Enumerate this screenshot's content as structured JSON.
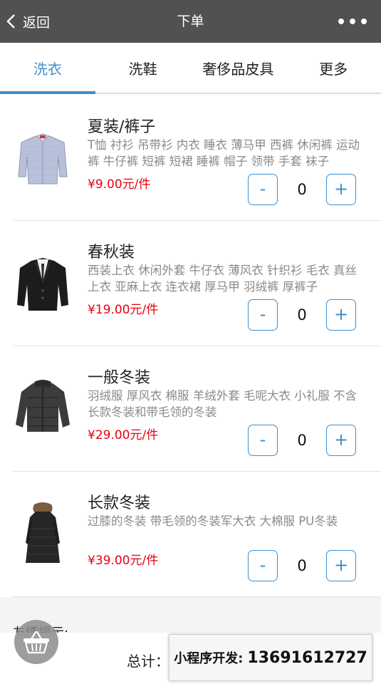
{
  "navbar": {
    "back_label": "返回",
    "title": "下单",
    "more_icon": "more-dots-icon"
  },
  "tabs": [
    {
      "label": "洗衣",
      "active": true
    },
    {
      "label": "洗鞋",
      "active": false
    },
    {
      "label": "奢侈品皮具",
      "active": false
    },
    {
      "label": "更多",
      "active": false
    }
  ],
  "items": [
    {
      "name": "夏装/裤子",
      "desc": "T恤 衬衫 吊带衫 内衣 睡衣 薄马甲 西裤 休闲裤 运动裤 牛仔裤 短裤 短裙 睡裤 帽子 领带 手套 袜子",
      "price": "¥9.00元/件",
      "count": "0",
      "minus": "-",
      "plus": "+",
      "image": "shirt"
    },
    {
      "name": "春秋装",
      "desc": "西装上衣 休闲外套 牛仔衣 薄风衣 针织衫 毛衣 真丝上衣 亚麻上衣 连衣裙 厚马甲 羽绒裤 厚裤子",
      "price": "¥19.00元/件",
      "count": "0",
      "minus": "-",
      "plus": "+",
      "image": "suit"
    },
    {
      "name": "一般冬装",
      "desc": "羽绒服 厚风衣 棉服 羊绒外套 毛呢大衣 小礼服 不含长款冬装和带毛领的冬装",
      "price": "¥29.00元/件",
      "count": "0",
      "minus": "-",
      "plus": "+",
      "image": "down-jacket"
    },
    {
      "name": "长款冬装",
      "desc": "过膝的冬装 带毛领的冬装军大衣 大棉服 PU冬装",
      "price": "¥39.00元/件",
      "count": "0",
      "minus": "-",
      "plus": "+",
      "image": "long-coat"
    }
  ],
  "notice": {
    "title": "友情提示:"
  },
  "footer": {
    "total_label": "总计："
  },
  "promo": {
    "label": "小程序开发:",
    "phone": "13691612727"
  },
  "colors": {
    "accent": "#3d8fcc",
    "price": "#e60012",
    "navbar": "#515151"
  }
}
